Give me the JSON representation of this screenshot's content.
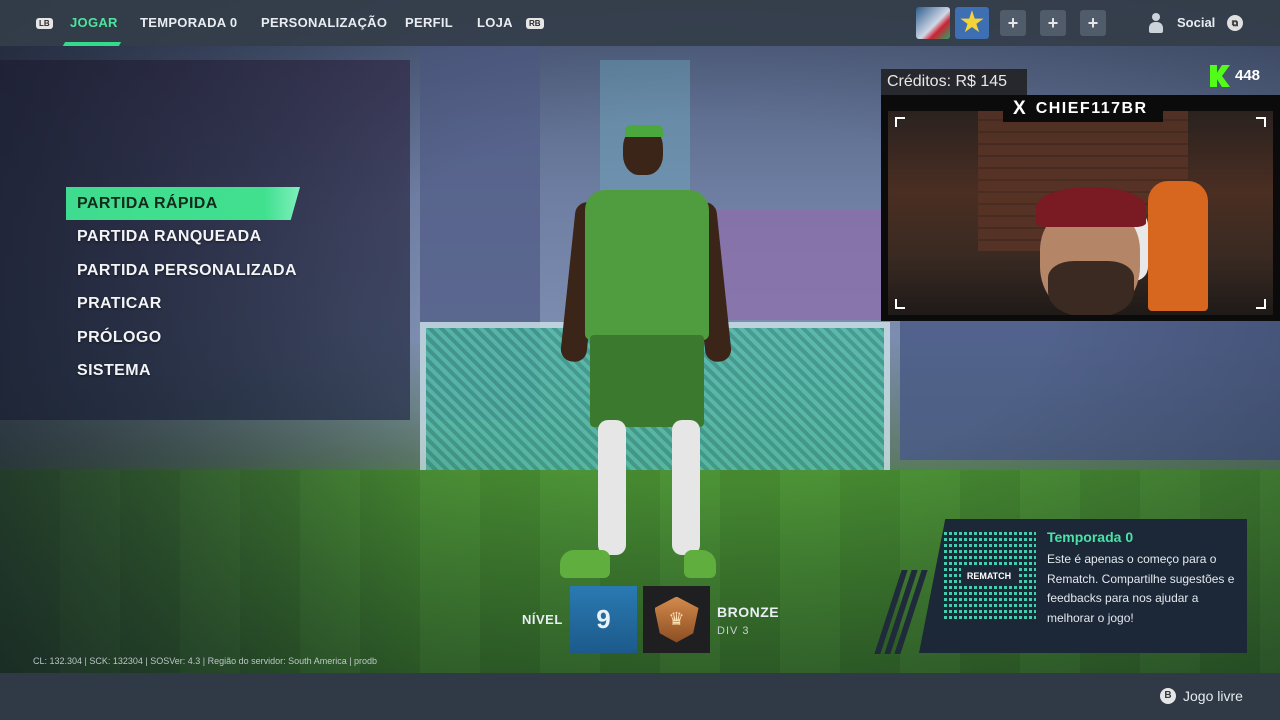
{
  "topbar": {
    "lb": "LB",
    "rb": "RB",
    "tabs": [
      "JOGAR",
      "TEMPORADA 0",
      "PERSONALIZAÇÃO",
      "PERFIL",
      "LOJA"
    ],
    "active_tab": "JOGAR",
    "plus": "+",
    "social": "Social"
  },
  "menu": {
    "items": [
      "PARTIDA RÁPIDA",
      "PARTIDA RANQUEADA",
      "PARTIDA PERSONALIZADA",
      "PRATICAR",
      "PRÓLOGO",
      "SISTEMA"
    ],
    "selected": "PARTIDA RÁPIDA"
  },
  "stream": {
    "credits": "Créditos: R$ 145",
    "viewers": "448",
    "x_icon": "X",
    "handle": "CHIEF117BR"
  },
  "player_status": {
    "level_label": "NÍVEL",
    "level": "9",
    "rank": "BRONZE",
    "division": "DIV 3"
  },
  "season_card": {
    "qr_label": "REMATCH",
    "title": "Temporada 0",
    "body": "Este é apenas o começo para o Rematch. Compartilhe sugestões e feedbacks para nos ajudar a melhorar o jogo!"
  },
  "version_info": "CL: 132.304 | SCK: 132304 | SOSVer: 4.3 | Região do servidor: South America | prodb",
  "bottombar": {
    "button": "B",
    "label": "Jogo livre"
  },
  "colors": {
    "accent": "#3fdc8f",
    "level_blue": "#2a7ab2",
    "kick_green": "#53fc18"
  }
}
